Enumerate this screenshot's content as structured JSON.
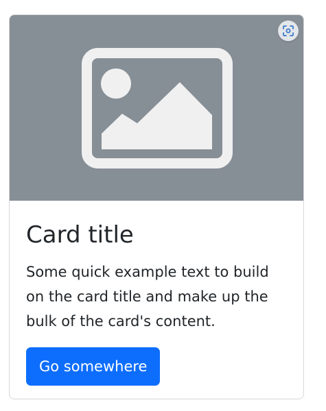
{
  "card": {
    "image": {
      "icon": "image-placeholder-icon",
      "background_color": "#868e96",
      "lens_icon": "visual-search-icon"
    },
    "title": "Card title",
    "text": "Some quick example text to build on the card title and make up the bulk of the card's content.",
    "button_label": "Go somewhere",
    "button_color": "#0d6efd"
  }
}
